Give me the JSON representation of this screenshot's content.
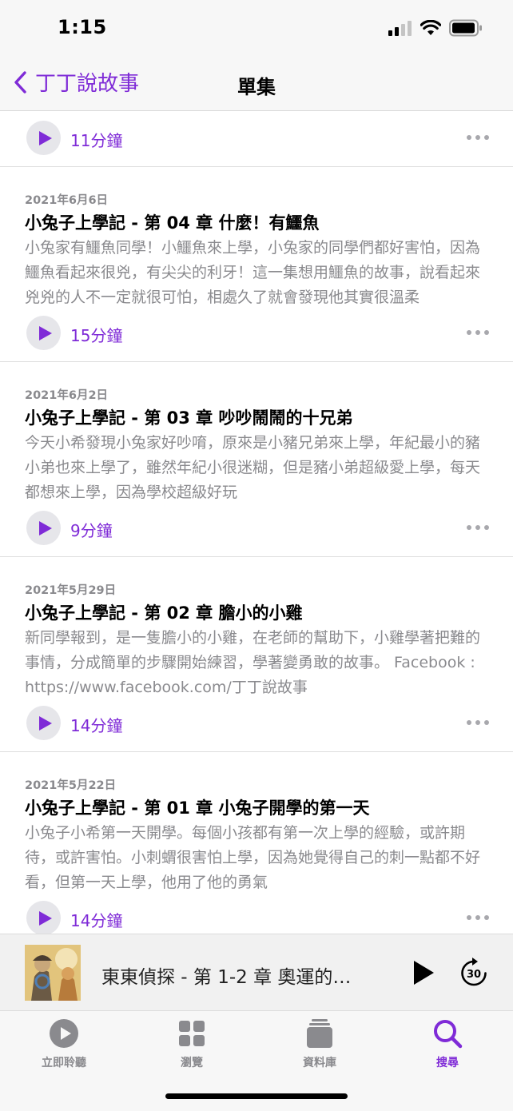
{
  "status_bar": {
    "time": "1:15"
  },
  "nav": {
    "back_label": "丁丁說故事",
    "title": "單集"
  },
  "episodes": [
    {
      "date": "",
      "title": "",
      "description": "",
      "duration": "11分鐘"
    },
    {
      "date": "2021年6月6日",
      "title": "小兔子上學記 - 第 04 章 什麼！有鱷魚",
      "description": "小兔家有鱷魚同學！小鱷魚來上學，小兔家的同學們都好害怕，因為鱷魚看起來很兇，有尖尖的利牙！這一集想用鱷魚的故事，說看起來兇兇的人不一定就很可怕，相處久了就會發現他其實很溫柔",
      "duration": "15分鐘"
    },
    {
      "date": "2021年6月2日",
      "title": "小兔子上學記 - 第 03 章 吵吵鬧鬧的十兄弟",
      "description": "今天小希發現小兔家好吵唷，原來是小豬兄弟來上學，年紀最小的豬小弟也來上學了，雖然年紀小很迷糊，但是豬小弟超級愛上學，每天都想來上學，因為學校超級好玩",
      "duration": "9分鐘"
    },
    {
      "date": "2021年5月29日",
      "title": "小兔子上學記 - 第 02 章 膽小的小雞",
      "description": "新同學報到，是一隻膽小的小雞，在老師的幫助下，小雞學著把難的事情，分成簡單的步驟開始練習，學著變勇敢的故事。 Facebook : https://www.facebook.com/丁丁說故事",
      "duration": "14分鐘"
    },
    {
      "date": "2021年5月22日",
      "title": "小兔子上學記 - 第 01 章 小兔子開學的第一天",
      "description": "小兔子小希第一天開學。每個小孩都有第一次上學的經驗，或許期待，或許害怕。小刺蝟很害怕上學，因為她覺得自己的刺一點都不好看，但第一天上學，他用了他的勇氣",
      "duration": "14分鐘"
    }
  ],
  "mini_player": {
    "title": "東東偵探 - 第 1-2 章 奧運的…"
  },
  "tabs": [
    {
      "label": "立即聆聽",
      "icon": "play-circle-icon",
      "active": false
    },
    {
      "label": "瀏覽",
      "icon": "grid-icon",
      "active": false
    },
    {
      "label": "資料庫",
      "icon": "library-stack-icon",
      "active": false
    },
    {
      "label": "搜尋",
      "icon": "search-icon",
      "active": true
    }
  ],
  "colors": {
    "accent": "#7f2bd7",
    "secondary_text": "#8a8a8e"
  }
}
